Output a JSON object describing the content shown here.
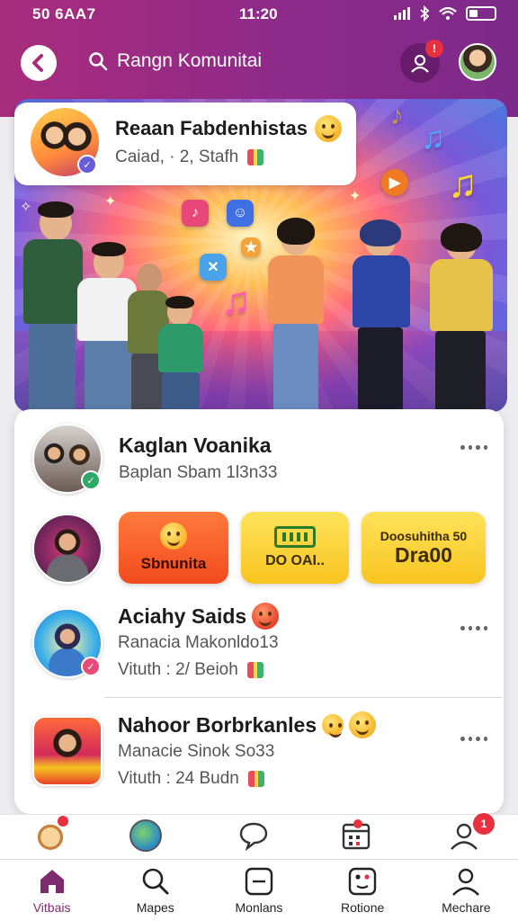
{
  "status_bar": {
    "carrier": "50 6AA7",
    "time": "11:20"
  },
  "header": {
    "search_text": "Rangn Komunitai",
    "notification_count": "!"
  },
  "hero": {
    "title": "Reaan Fabdenhistas",
    "meta": "Caiad, · 2, Stafh"
  },
  "feed": [
    {
      "title": "Kaglan Voanika",
      "subtitle": "Baplan Sbam 1l3n33"
    },
    {
      "title": "Aciahy Saids",
      "subtitle": "Ranacia Makonldo13",
      "meta": "Vituth : 2/ Beioh"
    },
    {
      "title": "Nahoor Borbrkanles",
      "subtitle": "Manacie Sinok So33",
      "meta": "Vituth : 24 Budn"
    }
  ],
  "chips": [
    {
      "label": "Sbnunita",
      "color": "#f24a1e"
    },
    {
      "label": "DO OAI..",
      "color": "#f7c41f"
    },
    {
      "label_top": "Doosuhitha 50",
      "label_bottom": "Dra00",
      "color": "#f7c41f"
    }
  ],
  "quick_actions": {
    "profile_badge": "1"
  },
  "tabs": [
    {
      "label": "Vitbais",
      "icon": "home-icon",
      "active": true
    },
    {
      "label": "Mapes",
      "icon": "search-icon"
    },
    {
      "label": "Monlans",
      "icon": "message-square-icon"
    },
    {
      "label": "Rotione",
      "icon": "dice-icon"
    },
    {
      "label": "Mechare",
      "icon": "person-icon"
    }
  ],
  "colors": {
    "header": "#9a2c84",
    "accent": "#7d2a6e",
    "badge": "#e8313e"
  }
}
